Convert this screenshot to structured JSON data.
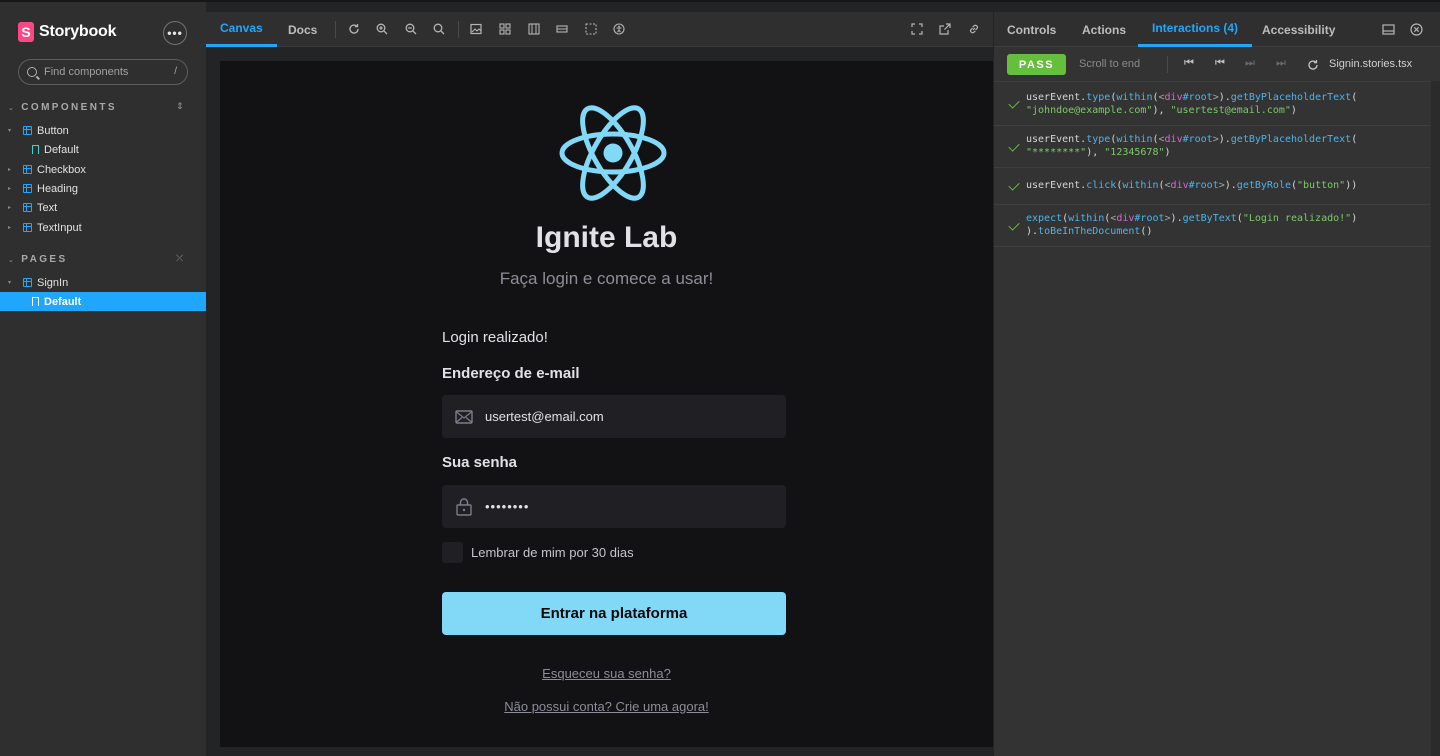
{
  "app": {
    "brand_name": "Storybook",
    "brand_mark": "S",
    "menu_label": "•••"
  },
  "search": {
    "placeholder": "Find components",
    "shortcut": "/"
  },
  "sidebar": {
    "components_heading": "COMPONENTS",
    "pages_heading": "PAGES",
    "components": [
      {
        "label": "Button"
      },
      {
        "label": "Default"
      },
      {
        "label": "Checkbox"
      },
      {
        "label": "Heading"
      },
      {
        "label": "Text"
      },
      {
        "label": "TextInput"
      }
    ],
    "pages": [
      {
        "label": "SignIn"
      },
      {
        "label": "Default"
      }
    ]
  },
  "canvas_toolbar": {
    "tabs": [
      "Canvas",
      "Docs"
    ]
  },
  "preview": {
    "title": "Ignite Lab",
    "subtitle": "Faça login e comece a usar!",
    "success_message": "Login realizado!",
    "email_label": "Endereço de e-mail",
    "email_value": "usertest@email.com",
    "password_label": "Sua senha",
    "password_value": "12345678",
    "remember_label": "Lembrar de mim por 30 dias",
    "submit_label": "Entrar na plataforma",
    "forgot_link": "Esqueceu sua senha?",
    "signup_link": "Não possui conta? Crie uma agora!",
    "accent_color": "#81d8f7"
  },
  "addons": {
    "tabs": [
      "Controls",
      "Actions",
      "Interactions (4)",
      "Accessibility"
    ],
    "status": "PASS",
    "scroll_to_end": "Scroll to end",
    "file_name": "Signin.stories.tsx"
  }
}
